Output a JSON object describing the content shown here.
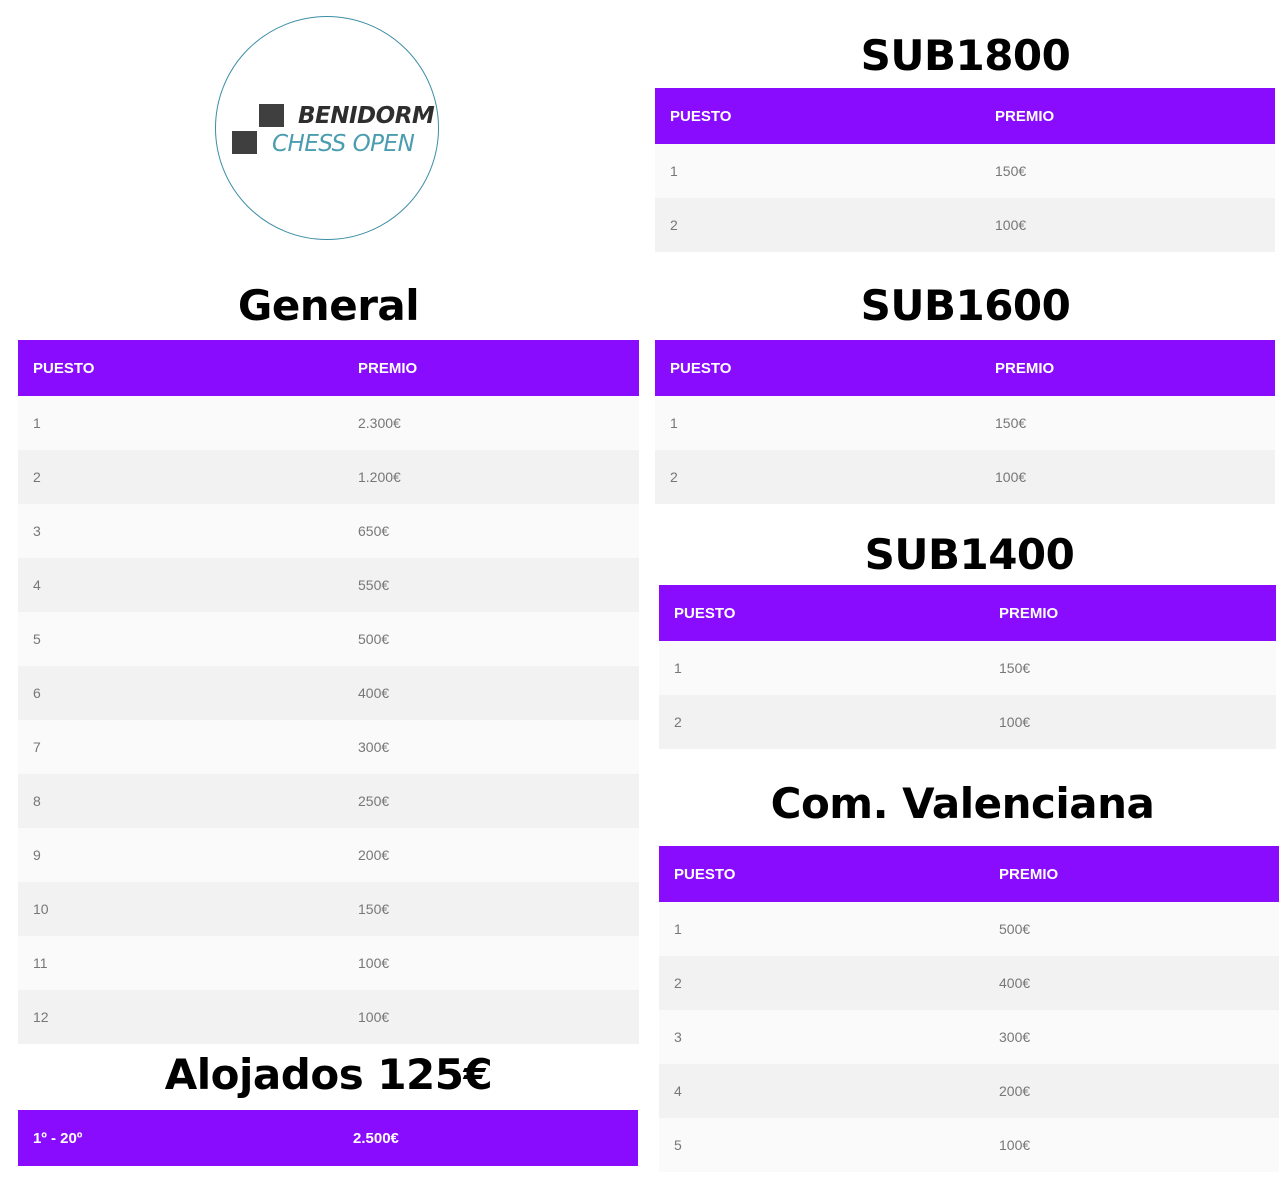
{
  "logo": {
    "line1": "BENIDORM",
    "line2": "CHESS OPEN"
  },
  "columns": {
    "puesto": "PUESTO",
    "premio": "PREMIO"
  },
  "general": {
    "title": "General",
    "rows": [
      {
        "pos": "1",
        "prize": "2.300€"
      },
      {
        "pos": "2",
        "prize": "1.200€"
      },
      {
        "pos": "3",
        "prize": "650€"
      },
      {
        "pos": "4",
        "prize": "550€"
      },
      {
        "pos": "5",
        "prize": "500€"
      },
      {
        "pos": "6",
        "prize": "400€"
      },
      {
        "pos": "7",
        "prize": "300€"
      },
      {
        "pos": "8",
        "prize": "250€"
      },
      {
        "pos": "9",
        "prize": "200€"
      },
      {
        "pos": "10",
        "prize": "150€"
      },
      {
        "pos": "11",
        "prize": "100€"
      },
      {
        "pos": "12",
        "prize": "100€"
      }
    ]
  },
  "alojados": {
    "title": "Alojados 125€",
    "row": {
      "pos": "1º - 20º",
      "prize": "2.500€"
    }
  },
  "sub1800": {
    "title": "SUB1800",
    "rows": [
      {
        "pos": "1",
        "prize": "150€"
      },
      {
        "pos": "2",
        "prize": "100€"
      }
    ]
  },
  "sub1600": {
    "title": "SUB1600",
    "rows": [
      {
        "pos": "1",
        "prize": "150€"
      },
      {
        "pos": "2",
        "prize": "100€"
      }
    ]
  },
  "sub1400": {
    "title": "SUB1400",
    "rows": [
      {
        "pos": "1",
        "prize": "150€"
      },
      {
        "pos": "2",
        "prize": "100€"
      }
    ]
  },
  "comval": {
    "title": "Com. Valenciana",
    "rows": [
      {
        "pos": "1",
        "prize": "500€"
      },
      {
        "pos": "2",
        "prize": "400€"
      },
      {
        "pos": "3",
        "prize": "300€"
      },
      {
        "pos": "4",
        "prize": "200€"
      },
      {
        "pos": "5",
        "prize": "100€"
      }
    ]
  },
  "colors": {
    "header": "#8a0cff",
    "logo_teal": "#4a9db0",
    "logo_dark": "#2e2e2e"
  }
}
